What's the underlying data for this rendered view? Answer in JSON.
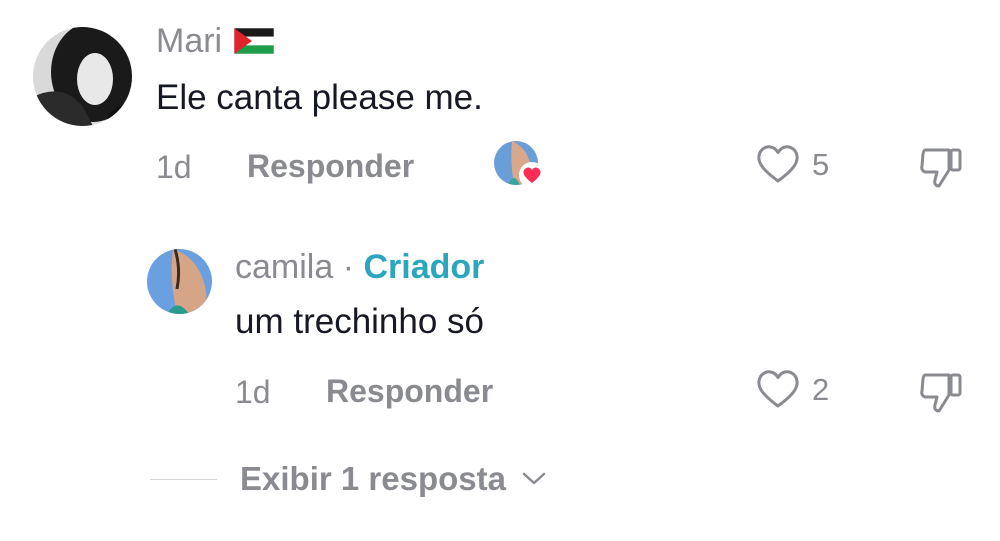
{
  "comments": [
    {
      "username": "Mari",
      "flag_icon": "palestine-flag-icon",
      "text": "Ele canta please me.",
      "time": "1d",
      "reply_label": "Responder",
      "liked_by_creator": true,
      "like_count": "5",
      "icons": {
        "like": "heart-outline-icon",
        "dislike": "thumbs-down-icon"
      }
    },
    {
      "username": "camila",
      "separator": "·",
      "badge": "Criador",
      "text": "um trechinho só",
      "time": "1d",
      "reply_label": "Responder",
      "like_count": "2",
      "icons": {
        "like": "heart-outline-icon",
        "dislike": "thumbs-down-icon"
      }
    }
  ],
  "view_replies": {
    "label": "Exibir 1 resposta",
    "icon": "chevron-down-icon"
  },
  "colors": {
    "accent": "#2aa6be",
    "muted": "#8a8b91",
    "text": "#161823",
    "heart": "#fe2c55"
  }
}
